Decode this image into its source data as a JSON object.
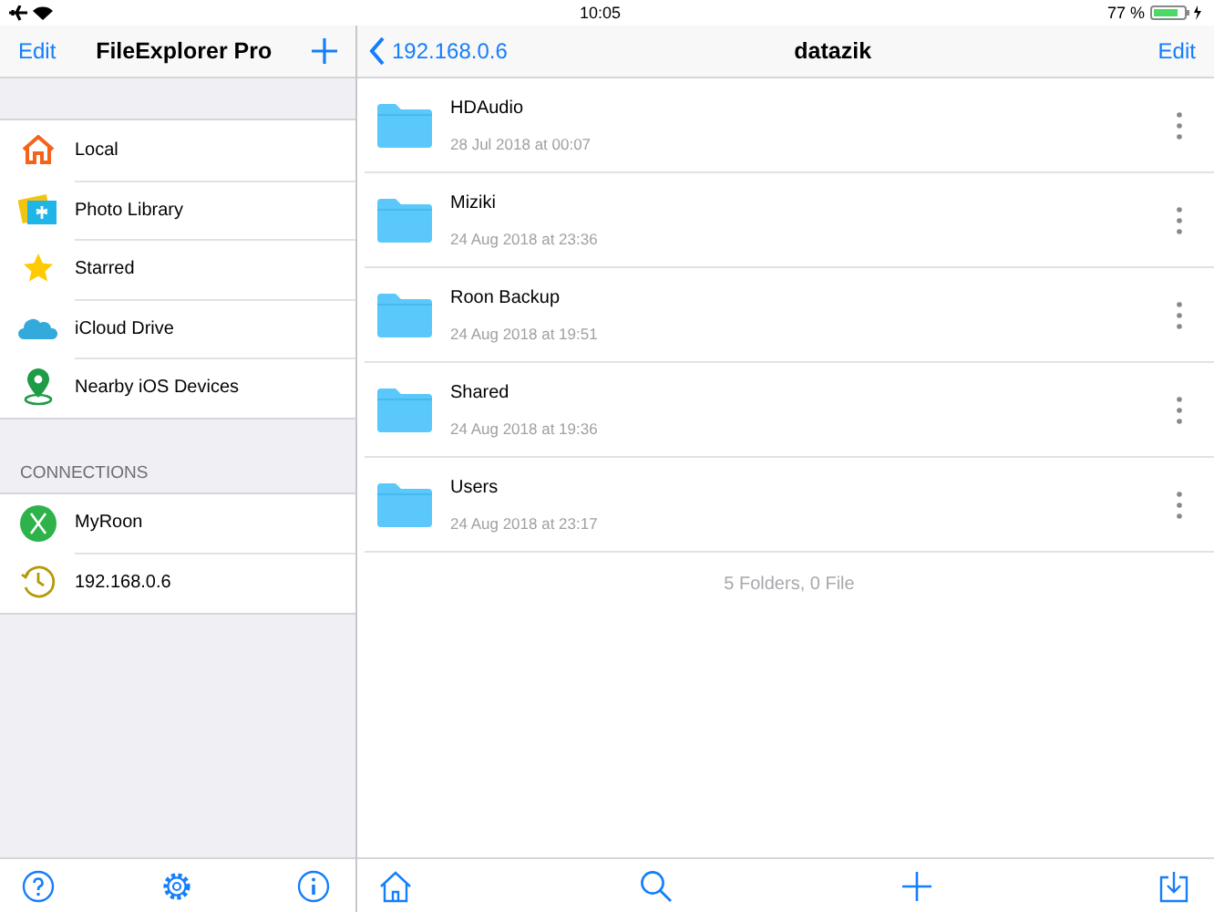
{
  "status_bar": {
    "time": "10:05",
    "battery": "77 %"
  },
  "sidebar": {
    "edit": "Edit",
    "title": "FileExplorer Pro",
    "items": [
      {
        "label": "Local"
      },
      {
        "label": "Photo Library"
      },
      {
        "label": "Starred"
      },
      {
        "label": "iCloud Drive"
      },
      {
        "label": "Nearby iOS Devices"
      }
    ],
    "section_header": "CONNECTIONS",
    "connections": [
      {
        "label": "MyRoon"
      },
      {
        "label": "192.168.0.6"
      }
    ]
  },
  "content": {
    "back": "192.168.0.6",
    "title": "datazik",
    "edit": "Edit",
    "rows": [
      {
        "name": "HDAudio",
        "date": "28 Jul 2018 at 00:07"
      },
      {
        "name": "Miziki",
        "date": "24 Aug 2018 at 23:36"
      },
      {
        "name": "Roon Backup",
        "date": "24 Aug 2018 at 19:51"
      },
      {
        "name": "Shared",
        "date": "24 Aug 2018 at 19:36"
      },
      {
        "name": "Users",
        "date": "24 Aug 2018 at 23:17"
      }
    ],
    "summary": "5 Folders, 0 File"
  }
}
